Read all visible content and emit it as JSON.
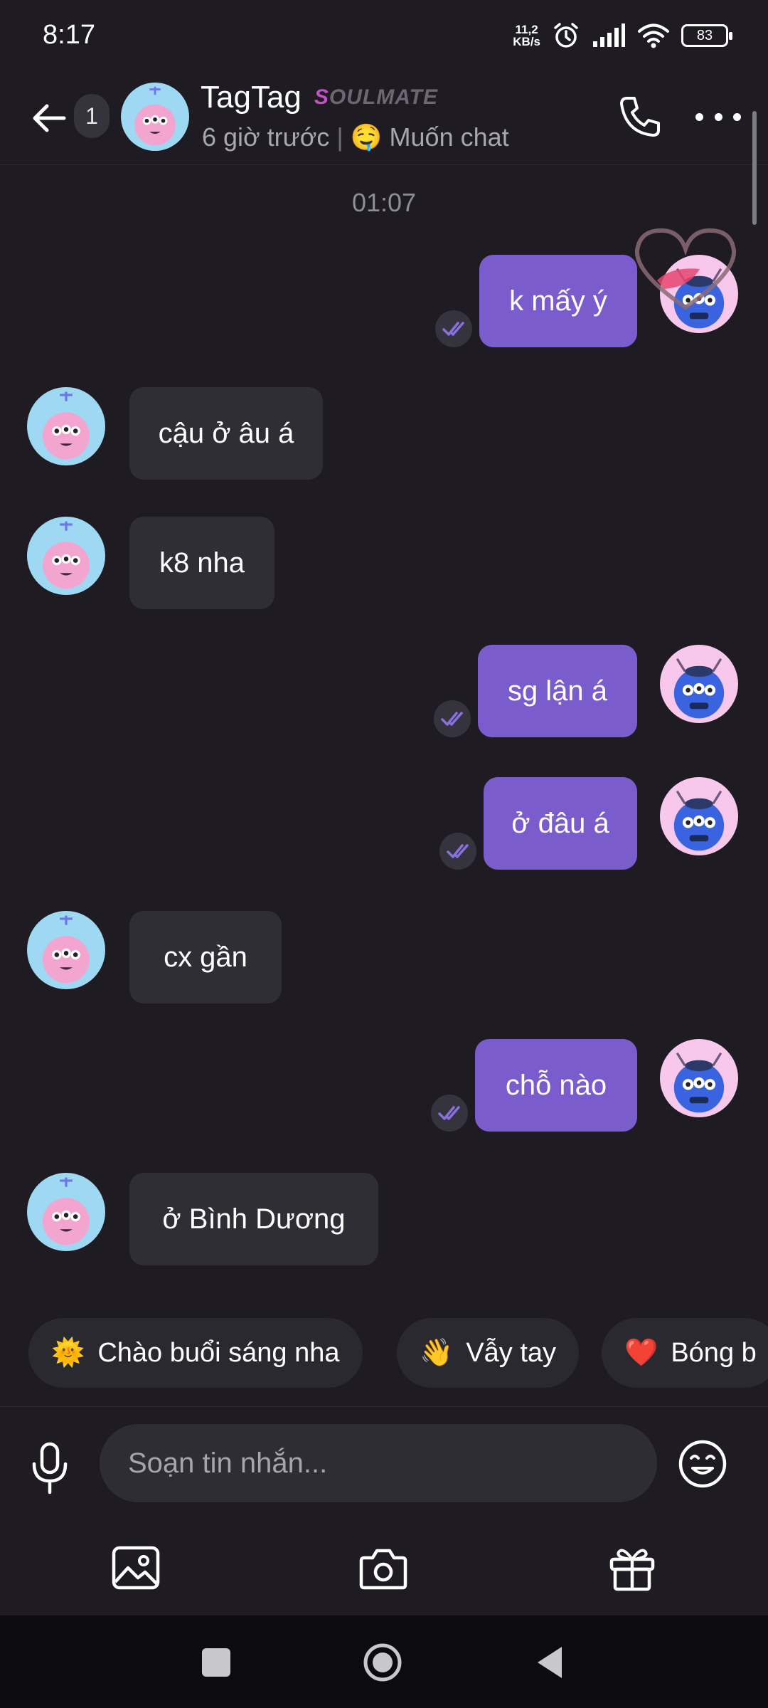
{
  "status_bar": {
    "time": "8:17",
    "net_speed_value": "11,2",
    "net_speed_unit": "KB/s",
    "battery": "83",
    "icons": [
      "alarm-icon",
      "signal-icon",
      "wifi-icon",
      "battery-icon"
    ]
  },
  "header": {
    "unread_count": "1",
    "contact_name": "TagTag",
    "badge_first": "S",
    "badge_rest": "OULMATE",
    "last_seen": "6 giờ trước",
    "separator": "|",
    "status_emoji": "🤤",
    "status_text": "Muốn chat"
  },
  "chat": {
    "timestamp": "01:07",
    "messages": [
      {
        "side": "out",
        "text": "k mấy ý",
        "read": true
      },
      {
        "side": "in",
        "text": "cậu ở âu á"
      },
      {
        "side": "in",
        "text": "k8 nha"
      },
      {
        "side": "out",
        "text": "sg lận á",
        "read": true
      },
      {
        "side": "out",
        "text": "ở đâu á",
        "read": true
      },
      {
        "side": "in",
        "text": "cx gần"
      },
      {
        "side": "out",
        "text": "chỗ nào",
        "read": true
      },
      {
        "side": "in",
        "text": "ở Bình Dương"
      }
    ]
  },
  "quick_replies": [
    {
      "emoji": "🌞",
      "label": "Chào buổi sáng nha"
    },
    {
      "emoji": "👋",
      "label": "Vẫy tay"
    },
    {
      "emoji": "❤️",
      "label": "Bóng b"
    }
  ],
  "composer": {
    "placeholder": "Soạn tin nhắn..."
  },
  "colors": {
    "background": "#1e1c22",
    "outgoing_bubble": "#7a5ccc",
    "incoming_bubble": "#302e35",
    "badge_accent": "#c94fc7"
  }
}
